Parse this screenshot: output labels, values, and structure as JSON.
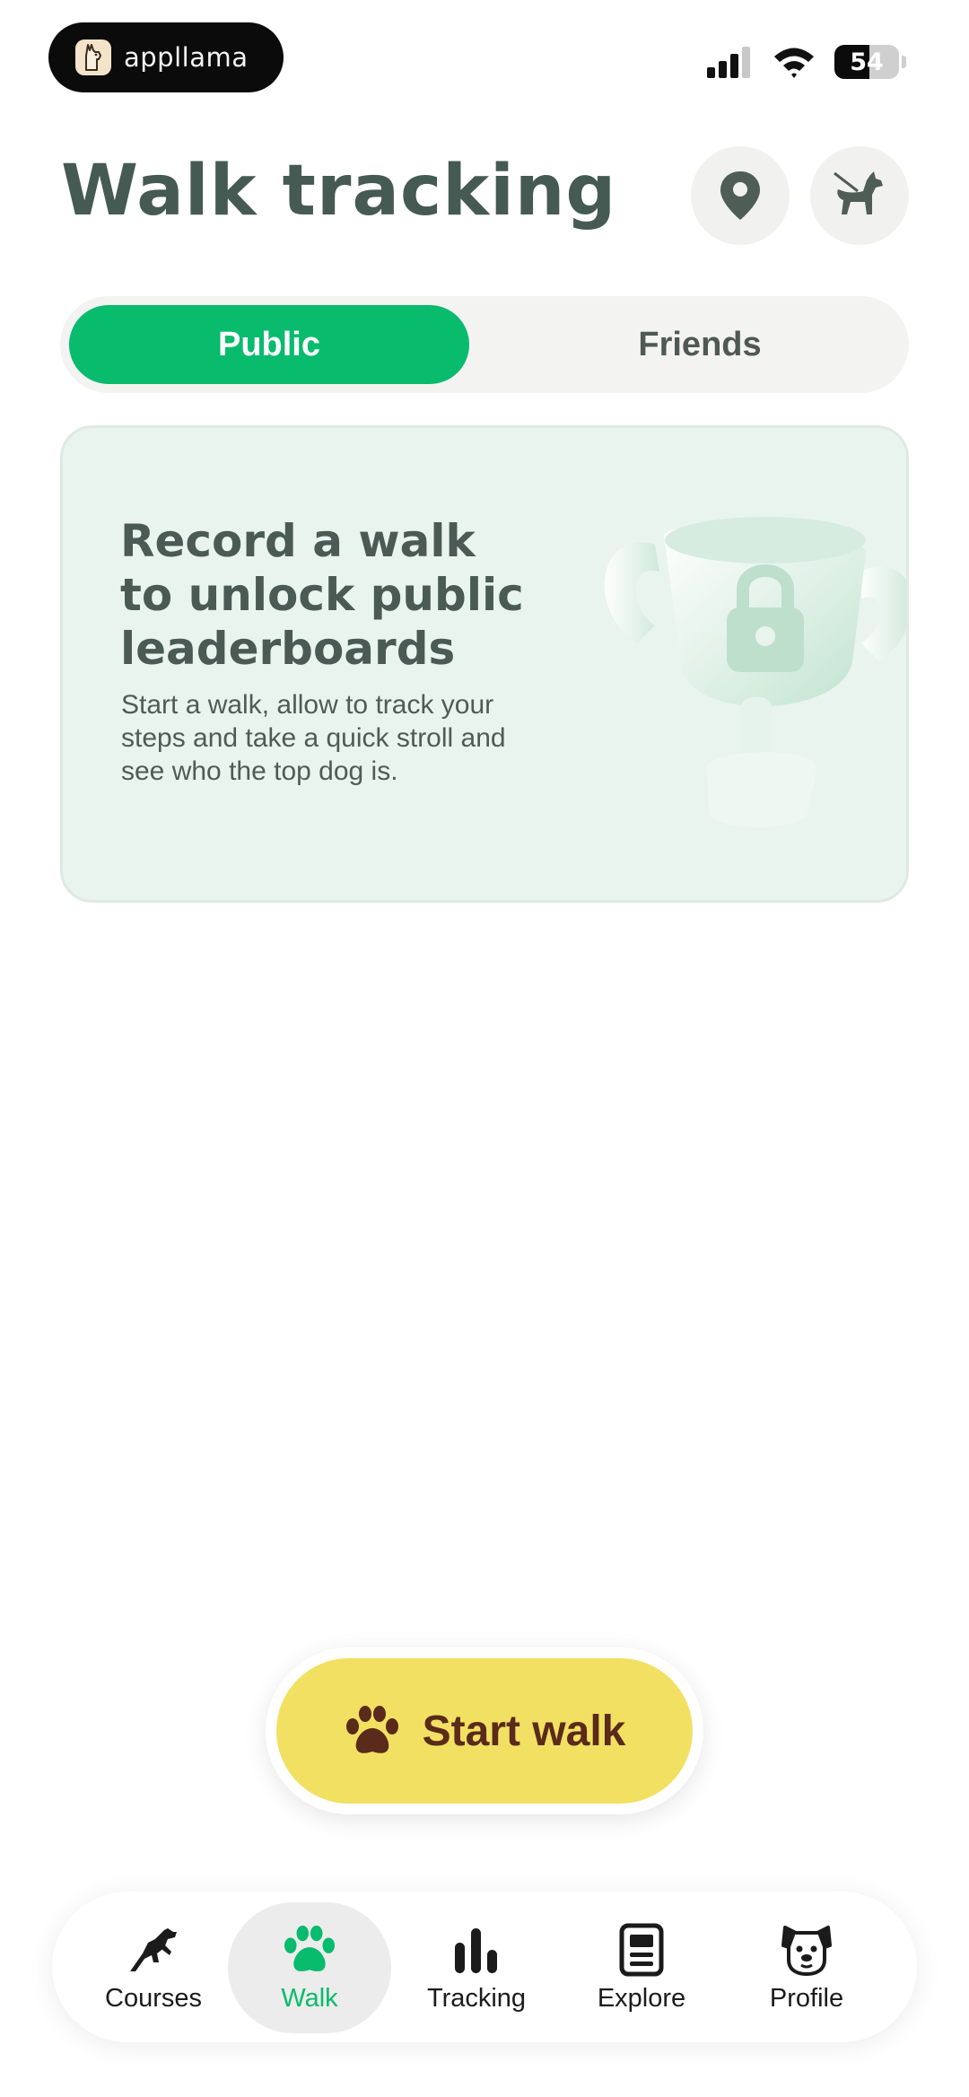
{
  "status_bar": {
    "brand_name": "appllama",
    "battery_level": "54",
    "icons": [
      "signal-icon",
      "wifi-icon",
      "battery-icon"
    ]
  },
  "header": {
    "title": "Walk tracking",
    "buttons": [
      "location-pin-icon",
      "dog-leash-icon"
    ]
  },
  "tabs": {
    "public_label": "Public",
    "friends_label": "Friends",
    "selected": "Public"
  },
  "card": {
    "title": "Record a walk to unlock public leaderboards",
    "body": "Start a walk, allow to track your steps and take a quick stroll and see who the top dog is.",
    "illustration": "locked-trophy-icon"
  },
  "start_walk": {
    "label": "Start walk",
    "icon": "paw-icon"
  },
  "nav": {
    "items": [
      {
        "label": "Courses",
        "icon": "jumping-dog-icon",
        "active": false
      },
      {
        "label": "Walk",
        "icon": "paw-icon",
        "active": true
      },
      {
        "label": "Tracking",
        "icon": "bar-chart-icon",
        "active": false
      },
      {
        "label": "Explore",
        "icon": "document-icon",
        "active": false
      },
      {
        "label": "Profile",
        "icon": "dog-face-icon",
        "active": false
      }
    ]
  },
  "colors": {
    "accent_green": "#08bb6d",
    "title_gray_green": "#455a52",
    "card_bg": "#e9f4ee",
    "start_yellow": "#f2e062",
    "start_text_brown": "#5a2a1a"
  }
}
